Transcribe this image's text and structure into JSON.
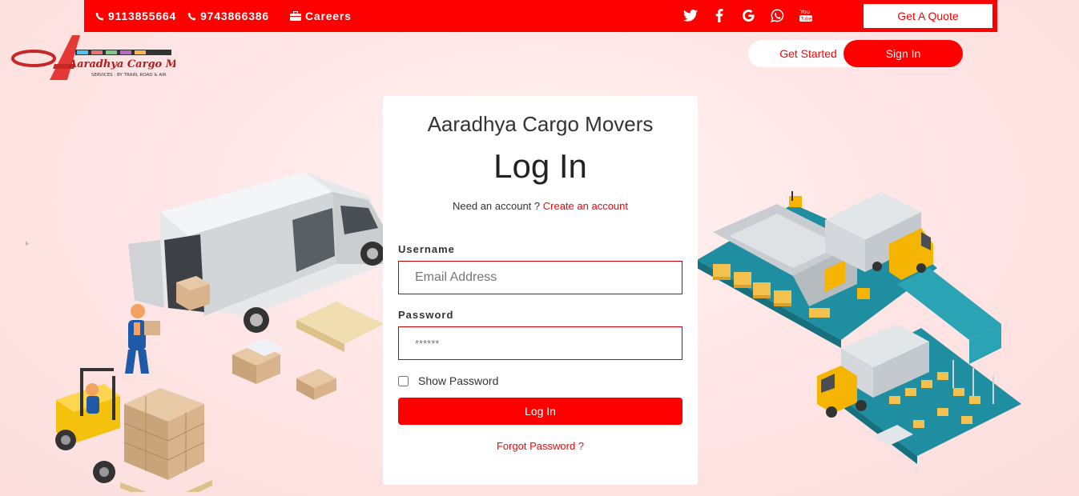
{
  "topbar": {
    "phone1": "9113855664",
    "phone2": "9743866386",
    "careers": "Careers",
    "social_icons": [
      "twitter-icon",
      "facebook-icon",
      "google-icon",
      "whatsapp-icon",
      "youtube-icon"
    ],
    "quote_label": "Get A Quote"
  },
  "brand": {
    "name": "Aaradhya Cargo Movers",
    "tagline": "SERVICES : BY TRAIN, ROAD & AIR"
  },
  "nav": {
    "get_started": "Get Started",
    "sign_in": "Sign In"
  },
  "form": {
    "site_name": "Aaradhya Cargo Movers",
    "title": "Log In",
    "need_account": "Need an account ?",
    "create_account": "Create an account",
    "username_label": "Username",
    "username_placeholder": "Email Address",
    "password_label": "Password",
    "password_placeholder": "******",
    "show_password": "Show Password",
    "login_button": "Log In",
    "forgot": "Forgot Password ?"
  },
  "colors": {
    "accent": "#ff0000",
    "background": "#ffe6e6",
    "card": "#ffffff"
  }
}
